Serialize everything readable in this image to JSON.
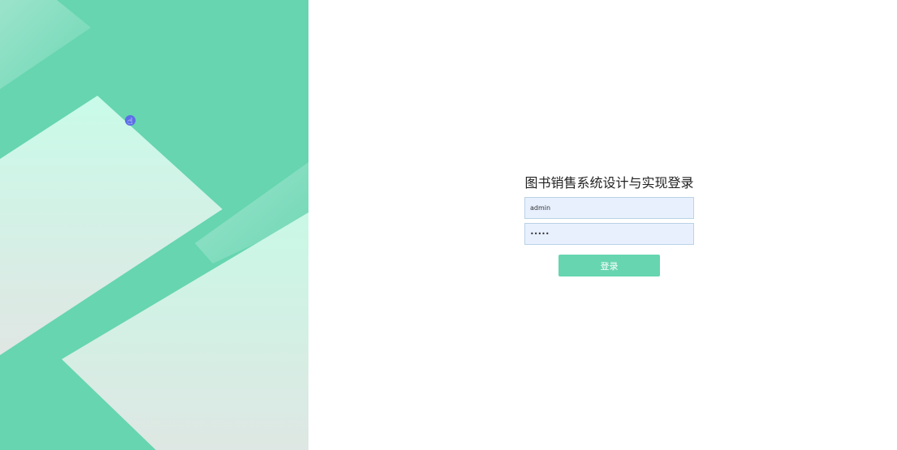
{
  "login": {
    "title": "图书销售系统设计与实现登录",
    "username_value": "admin",
    "password_value": "•••••",
    "button_label": "登录"
  },
  "colors": {
    "background_green": "#66d5b0",
    "shape_light": "#c9fbe9",
    "shape_fade": "#e2e8e4",
    "input_fill": "#e8f0fe",
    "button": "#66d5b0",
    "cursor": "#5d6fe6"
  },
  "icons": {
    "cursor": "hand-pointer-icon"
  }
}
